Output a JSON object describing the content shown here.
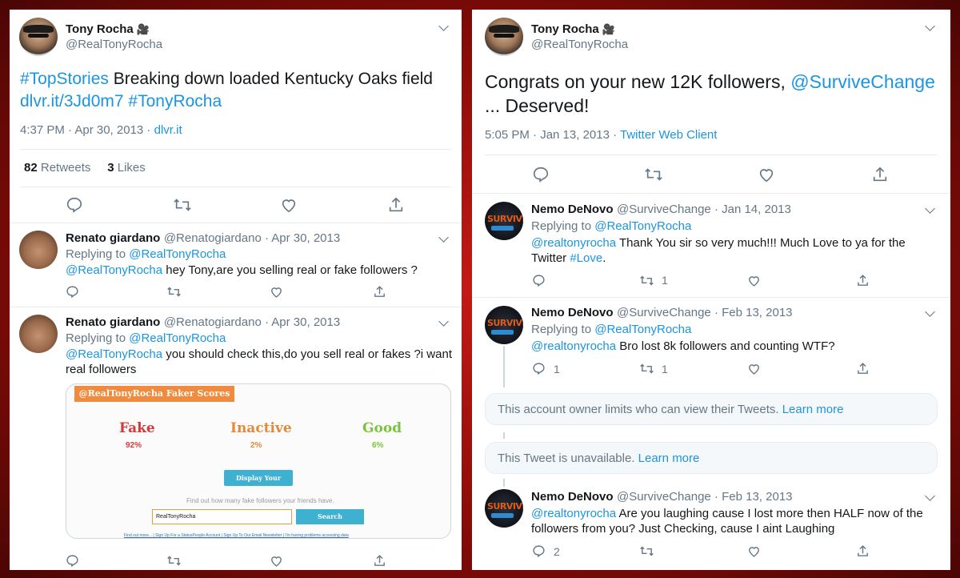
{
  "left": {
    "main": {
      "name": "Tony Rocha",
      "badge": "🎥",
      "handle": "@RealTonyRocha",
      "text_hashtag": "#TopStories",
      "text_main": " Breaking down loaded Kentucky Oaks field",
      "text_link": "dlvr.it/3Jd0m7",
      "text_hashtag2": "#TonyRocha",
      "time": "4:37 PM · Apr 30, 2013 ·",
      "source": "dlvr.it",
      "retweets_count": "82",
      "retweets_label": "Retweets",
      "likes_count": "3",
      "likes_label": "Likes"
    },
    "replies": [
      {
        "name": "Renato giardano",
        "handle": "@Renatogiardano · Apr 30, 2013",
        "replying": "Replying to ",
        "replying_to": "@RealTonyRocha",
        "mention": "@RealTonyRocha",
        "text": " hey Tony,are you selling real or fake followers ?"
      },
      {
        "name": "Renato giardano",
        "handle": "@Renatogiardano · Apr 30, 2013",
        "replying": "Replying to ",
        "replying_to": "@RealTonyRocha",
        "mention": "@RealTonyRocha",
        "text": " you should check this,do you sell real or fakes ?i want",
        "text2": "real followers"
      }
    ],
    "card": {
      "header": "@RealTonyRocha Faker Scores",
      "fake_label": "Fake",
      "fake_value": "92%",
      "inactive_label": "Inactive",
      "inactive_value": "2%",
      "good_label": "Good",
      "good_value": "6%",
      "display_button": "Display Your Scores",
      "prompt": "Find out how many fake followers your friends have.",
      "input_value": "RealTonyRocha",
      "search_button": "Search",
      "footer": "Find out more... | Sign Up For a StatusPeople Account | Sign Up To Our Email Newsletter | I'm having problems accessing data",
      "colors": {
        "header": "#f08a3c",
        "fake": "#d43a3a",
        "inactive": "#e08a3a",
        "good": "#7ac43a",
        "button": "#3fb1d0"
      }
    }
  },
  "right": {
    "main": {
      "name": "Tony Rocha",
      "badge": "🎥",
      "handle": "@RealTonyRocha",
      "text1": "Congrats on your new 12K followers, ",
      "mention": "@SurviveChange",
      "text2": "... Deserved!",
      "time": "5:05 PM · Jan 13, 2013 ·",
      "source": "Twitter Web Client"
    },
    "replies": [
      {
        "name": "Nemo DeNovo",
        "handle": "@SurviveChange · Jan 14, 2013",
        "replying": "Replying to ",
        "replying_to": "@RealTonyRocha",
        "mention": "@realtonyrocha",
        "text": " Thank You sir so very much!!!  Much Love to ya for the",
        "text2_pre": "Twitter ",
        "text2_tag": "#Love",
        "text2_post": ".",
        "retweet_count": "1"
      },
      {
        "name": "Nemo DeNovo",
        "handle": "@SurviveChange · Feb 13, 2013",
        "replying": "Replying to ",
        "replying_to": "@RealTonyRocha",
        "mention": "@realtonyrocha",
        "text": " Bro lost 8k followers and counting WTF?",
        "reply_count": "1",
        "retweet_count": "1"
      },
      {
        "name": "Nemo DeNovo",
        "handle": "@SurviveChange · Feb 13, 2013",
        "mention": "@realtonyrocha",
        "text": " Are you laughing cause I lost more then HALF now of the",
        "text2": "followers from you?  Just Checking, cause I aint Laughing",
        "reply_count": "2"
      }
    ],
    "notice1_text": "This account owner limits who can view their Tweets. ",
    "notice1_link": "Learn more",
    "notice2_text": "This Tweet is unavailable. ",
    "notice2_link": "Learn more",
    "avatar_text": "SURVIVE"
  }
}
